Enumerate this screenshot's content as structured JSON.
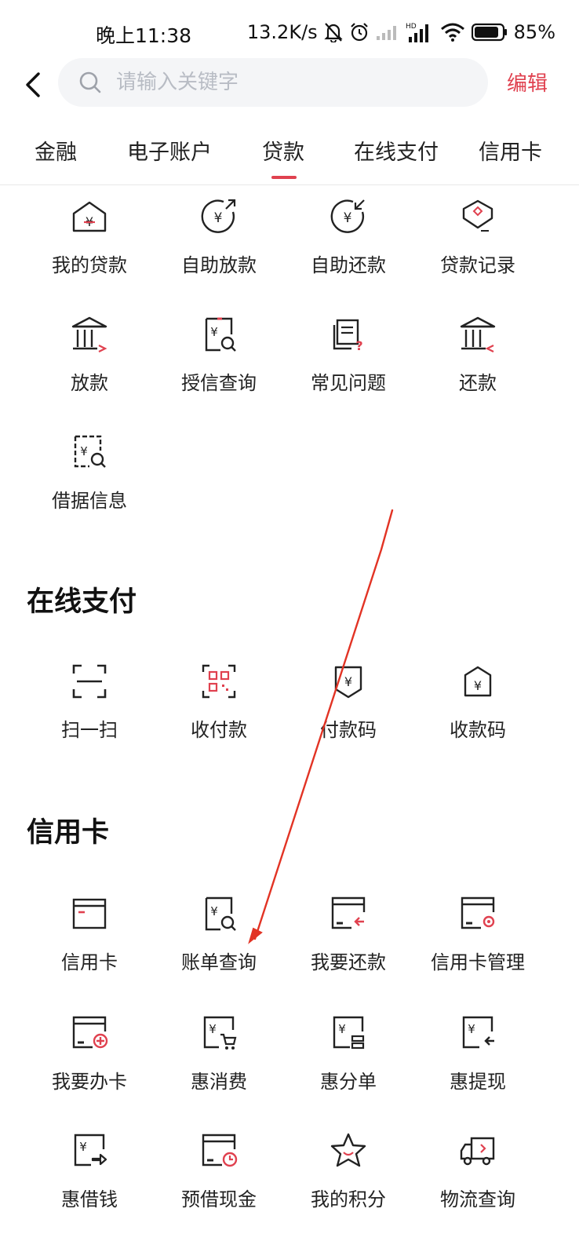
{
  "status": {
    "time": "晚上11:38",
    "speed": "13.2K/s",
    "battery": "85%"
  },
  "search": {
    "placeholder": "请输入关键字"
  },
  "header": {
    "edit_label": "编辑"
  },
  "tabs": [
    "金融",
    "电子账户",
    "贷款",
    "在线支付",
    "信用卡"
  ],
  "active_tab": "贷款",
  "loans": {
    "items": [
      "我的贷款",
      "自助放款",
      "自助还款",
      "贷款记录",
      "放款",
      "授信查询",
      "常见问题",
      "还款",
      "借据信息"
    ]
  },
  "online_pay": {
    "title": "在线支付",
    "items": [
      "扫一扫",
      "收付款",
      "付款码",
      "收款码"
    ]
  },
  "credit_card": {
    "title": "信用卡",
    "items": [
      "信用卡",
      "账单查询",
      "我要还款",
      "信用卡管理",
      "我要办卡",
      "惠消费",
      "惠分单",
      "惠提现",
      "惠借钱",
      "预借现金",
      "我的积分",
      "物流查询"
    ]
  },
  "colors": {
    "accent": "#e0414f",
    "icon_stroke": "#222222"
  }
}
